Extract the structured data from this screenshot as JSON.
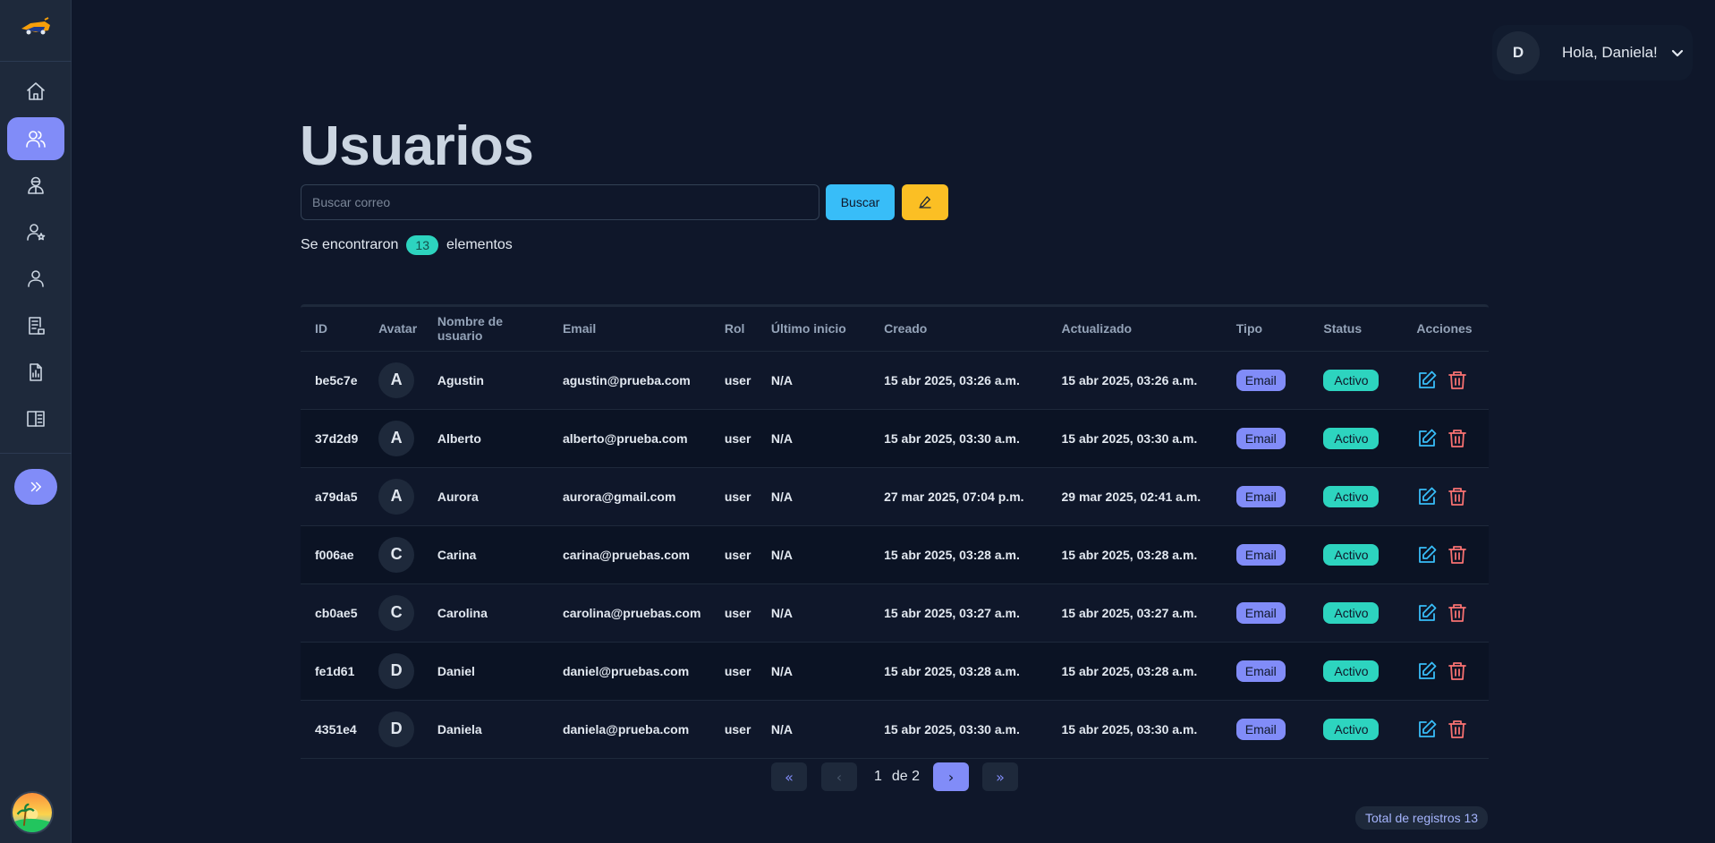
{
  "user_menu": {
    "avatar_letter": "D",
    "greeting": "Hola, Daniela!"
  },
  "sidebar": {
    "items": [
      {
        "icon": "home-icon"
      },
      {
        "icon": "users-icon",
        "active": true
      },
      {
        "icon": "agent-icon"
      },
      {
        "icon": "user-star-icon"
      },
      {
        "icon": "user-icon"
      },
      {
        "icon": "report-list-icon"
      },
      {
        "icon": "chart-report-icon"
      },
      {
        "icon": "book-open-icon"
      }
    ],
    "expand_icon": "chevrons-right-icon"
  },
  "page": {
    "title": "Usuarios",
    "search_placeholder": "Buscar correo",
    "search_value": "",
    "search_button": "Buscar",
    "found_prefix": "Se encontraron",
    "found_count": "13",
    "found_suffix": "elementos"
  },
  "table": {
    "headers": [
      "ID",
      "Avatar",
      "Nombre de usuario",
      "Email",
      "Rol",
      "Último inicio",
      "Creado",
      "Actualizado",
      "Tipo",
      "Status",
      "Acciones"
    ],
    "rows": [
      {
        "id": "be5c7e",
        "avatar": "A",
        "name": "Agustin",
        "email": "agustin@prueba.com",
        "rol": "user",
        "last": "N/A",
        "created": "15 abr 2025, 03:26 a.m.",
        "updated": "15 abr 2025, 03:26 a.m.",
        "tipo": "Email",
        "status": "Activo"
      },
      {
        "id": "37d2d9",
        "avatar": "A",
        "name": "Alberto",
        "email": "alberto@prueba.com",
        "rol": "user",
        "last": "N/A",
        "created": "15 abr 2025, 03:30 a.m.",
        "updated": "15 abr 2025, 03:30 a.m.",
        "tipo": "Email",
        "status": "Activo"
      },
      {
        "id": "a79da5",
        "avatar": "A",
        "name": "Aurora",
        "email": "aurora@gmail.com",
        "rol": "user",
        "last": "N/A",
        "created": "27 mar 2025, 07:04 p.m.",
        "updated": "29 mar 2025, 02:41 a.m.",
        "tipo": "Email",
        "status": "Activo"
      },
      {
        "id": "f006ae",
        "avatar": "C",
        "name": "Carina",
        "email": "carina@pruebas.com",
        "rol": "user",
        "last": "N/A",
        "created": "15 abr 2025, 03:28 a.m.",
        "updated": "15 abr 2025, 03:28 a.m.",
        "tipo": "Email",
        "status": "Activo"
      },
      {
        "id": "cb0ae5",
        "avatar": "C",
        "name": "Carolina",
        "email": "carolina@pruebas.com",
        "rol": "user",
        "last": "N/A",
        "created": "15 abr 2025, 03:27 a.m.",
        "updated": "15 abr 2025, 03:27 a.m.",
        "tipo": "Email",
        "status": "Activo"
      },
      {
        "id": "fe1d61",
        "avatar": "D",
        "name": "Daniel",
        "email": "daniel@pruebas.com",
        "rol": "user",
        "last": "N/A",
        "created": "15 abr 2025, 03:28 a.m.",
        "updated": "15 abr 2025, 03:28 a.m.",
        "tipo": "Email",
        "status": "Activo"
      },
      {
        "id": "4351e4",
        "avatar": "D",
        "name": "Daniela",
        "email": "daniela@prueba.com",
        "rol": "user",
        "last": "N/A",
        "created": "15 abr 2025, 03:30 a.m.",
        "updated": "15 abr 2025, 03:30 a.m.",
        "tipo": "Email",
        "status": "Activo"
      }
    ],
    "row_icons": {
      "edit": "edit-icon",
      "delete": "trash-icon"
    }
  },
  "pagination": {
    "first": "«",
    "prev": "‹",
    "page": "1",
    "of_label": "de 2",
    "next": "›",
    "last": "»"
  },
  "footer": {
    "total": "Total de registros 13"
  },
  "colors": {
    "accent": "#818cf8",
    "search_button": "#38bdf8",
    "edit_button": "#fbbf24",
    "status": "#2dd4bf",
    "delete": "#f87171",
    "background": "#0f172a",
    "sidebar": "#1e293b"
  }
}
